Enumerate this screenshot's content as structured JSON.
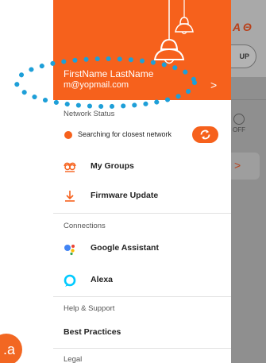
{
  "marker": {
    "label": ".a"
  },
  "background_app": {
    "logo_text": "A Θ",
    "pill_label": "UP",
    "off_label": "OFF",
    "card_arrow": ">"
  },
  "drawer": {
    "user": {
      "name": "FirstName LastName",
      "email": "m@yopmail.com"
    },
    "header_chevron": ">",
    "network": {
      "section_label": "Network Status",
      "status_text": "Searching for closest network"
    },
    "items": [
      {
        "label": "My Groups",
        "icon": "groups-icon"
      },
      {
        "label": "Firmware Update",
        "icon": "download-icon"
      }
    ],
    "connections": {
      "section_label": "Connections",
      "items": [
        {
          "label": "Google Assistant",
          "icon": "google-assistant-icon"
        },
        {
          "label": "Alexa",
          "icon": "alexa-icon"
        }
      ]
    },
    "help": {
      "section_label": "Help & Support",
      "items": [
        {
          "label": "Best Practices"
        }
      ]
    },
    "legal": {
      "section_label": "Legal"
    }
  },
  "colors": {
    "accent": "#f6611c",
    "annotation": "#1e9fd8"
  }
}
